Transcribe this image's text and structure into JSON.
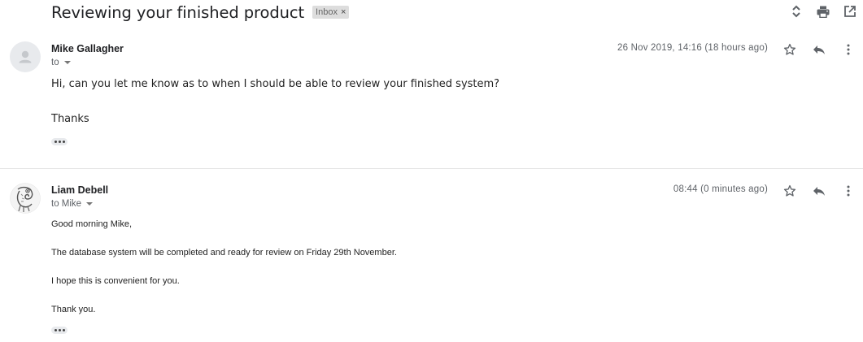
{
  "thread": {
    "subject": "Reviewing your finished product",
    "label": "Inbox",
    "label_remove": "×"
  },
  "top_actions": [
    {
      "name": "expand-all-icon"
    },
    {
      "name": "print-icon"
    },
    {
      "name": "open-in-new-window-icon"
    }
  ],
  "messages": [
    {
      "sender": "Mike Gallagher",
      "to": "to",
      "timestamp": "26 Nov 2019, 14:16 (18 hours ago)",
      "avatar": "default-person-avatar",
      "body": [
        "Hi, can you let me know as to when I should be able to review your finished system?",
        "Thanks"
      ]
    },
    {
      "sender": "Liam Debell",
      "to": "to Mike",
      "timestamp": "08:44 (0 minutes ago)",
      "avatar": "chameleon-avatar",
      "body": [
        "Good morning Mike,",
        "The database system will be completed and ready for review on Friday 29th November.",
        "I hope this is convenient for you.",
        "Thank you."
      ]
    }
  ],
  "colors": {
    "text": "#222222",
    "secondary": "#5f6368",
    "icon": "#5f6368",
    "chip": "#dddddd"
  }
}
